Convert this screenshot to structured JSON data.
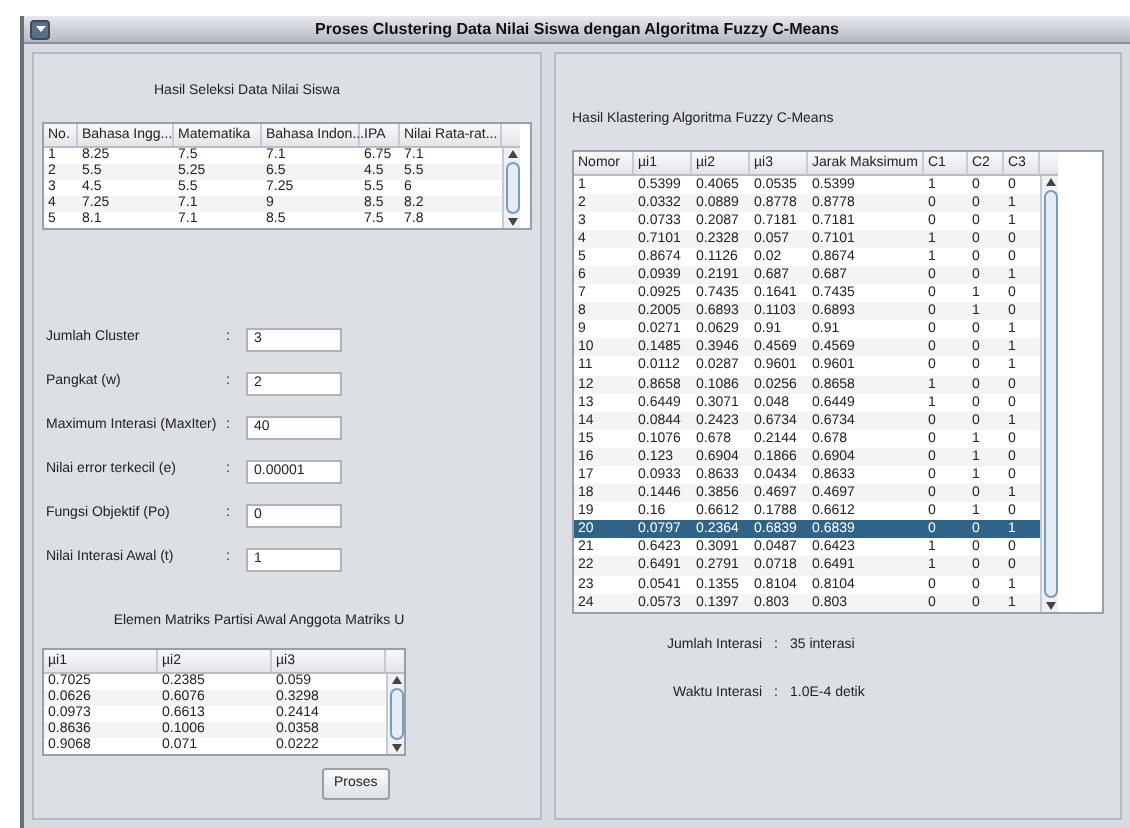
{
  "window": {
    "title": "Proses Clustering Data Nilai Siswa dengan Algoritma Fuzzy C-Means"
  },
  "selection_table": {
    "title": "Hasil Seleksi Data Nilai Siswa",
    "columns": [
      "No.",
      "Bahasa Ingg...",
      "Matematika",
      "Bahasa Indon...",
      "IPA",
      "Nilai Rata-rat..."
    ],
    "rows": [
      [
        "1",
        "8.25",
        "7.5",
        "7.1",
        "6.75",
        "7.1"
      ],
      [
        "2",
        "5.5",
        "5.25",
        "6.5",
        "4.5",
        "5.5"
      ],
      [
        "3",
        "4.5",
        "5.5",
        "7.25",
        "5.5",
        "6"
      ],
      [
        "4",
        "7.25",
        "7.1",
        "9",
        "8.5",
        "8.2"
      ],
      [
        "5",
        "8.1",
        "7.1",
        "8.5",
        "7.5",
        "7.8"
      ]
    ]
  },
  "params": [
    {
      "label": "Jumlah Cluster",
      "separator": ":",
      "value": "3"
    },
    {
      "label": "Pangkat (w)",
      "separator": ":",
      "value": "2"
    },
    {
      "label": "Maximum Interasi (MaxIter)",
      "separator": ":",
      "value": "40"
    },
    {
      "label": "Nilai error terkecil (e)",
      "separator": ":",
      "value": "0.00001"
    },
    {
      "label": "Fungsi Objektif (Po)",
      "separator": ":",
      "value": "0"
    },
    {
      "label": "Nilai Interasi Awal (t)",
      "separator": ":",
      "value": "1"
    }
  ],
  "matrix_table": {
    "title": "Elemen Matriks Partisi Awal Anggota Matriks U",
    "columns": [
      "µi1",
      "µi2",
      "µi3"
    ],
    "rows": [
      [
        "0.7025",
        "0.2385",
        "0.059"
      ],
      [
        "0.0626",
        "0.6076",
        "0.3298"
      ],
      [
        "0.0973",
        "0.6613",
        "0.2414"
      ],
      [
        "0.8636",
        "0.1006",
        "0.0358"
      ],
      [
        "0.9068",
        "0.071",
        "0.0222"
      ]
    ]
  },
  "process_button": "Proses",
  "result_table": {
    "title": "Hasil Klastering Algoritma Fuzzy C-Means",
    "columns": [
      "Nomor",
      "µi1",
      "µi2",
      "µi3",
      "Jarak Maksimum",
      "C1",
      "C2",
      "C3"
    ],
    "rows": [
      {
        "cells": [
          "1",
          "0.5399",
          "0.4065",
          "0.0535",
          "0.5399",
          "1",
          "0",
          "0"
        ],
        "selected": false
      },
      {
        "cells": [
          "2",
          "0.0332",
          "0.0889",
          "0.8778",
          "0.8778",
          "0",
          "0",
          "1"
        ],
        "selected": false
      },
      {
        "cells": [
          "3",
          "0.0733",
          "0.2087",
          "0.7181",
          "0.7181",
          "0",
          "0",
          "1"
        ],
        "selected": false
      },
      {
        "cells": [
          "4",
          "0.7101",
          "0.2328",
          "0.057",
          "0.7101",
          "1",
          "0",
          "0"
        ],
        "selected": false
      },
      {
        "cells": [
          "5",
          "0.8674",
          "0.1126",
          "0.02",
          "0.8674",
          "1",
          "0",
          "0"
        ],
        "selected": false
      },
      {
        "cells": [
          "6",
          "0.0939",
          "0.2191",
          "0.687",
          "0.687",
          "0",
          "0",
          "1"
        ],
        "selected": false
      },
      {
        "cells": [
          "7",
          "0.0925",
          "0.7435",
          "0.1641",
          "0.7435",
          "0",
          "1",
          "0"
        ],
        "selected": false
      },
      {
        "cells": [
          "8",
          "0.2005",
          "0.6893",
          "0.1103",
          "0.6893",
          "0",
          "1",
          "0"
        ],
        "selected": false
      },
      {
        "cells": [
          "9",
          "0.0271",
          "0.0629",
          "0.91",
          "0.91",
          "0",
          "0",
          "1"
        ],
        "selected": false
      },
      {
        "cells": [
          "10",
          "0.1485",
          "0.3946",
          "0.4569",
          "0.4569",
          "0",
          "0",
          "1"
        ],
        "selected": false
      },
      {
        "cells": [
          "11",
          "0.0112",
          "0.0287",
          "0.9601",
          "0.9601",
          "0",
          "0",
          "1"
        ],
        "selected": false
      },
      {
        "cells": [
          "12",
          "0.8658",
          "0.1086",
          "0.0256",
          "0.8658",
          "1",
          "0",
          "0"
        ],
        "selected": false
      },
      {
        "cells": [
          "13",
          "0.6449",
          "0.3071",
          "0.048",
          "0.6449",
          "1",
          "0",
          "0"
        ],
        "selected": false
      },
      {
        "cells": [
          "14",
          "0.0844",
          "0.2423",
          "0.6734",
          "0.6734",
          "0",
          "0",
          "1"
        ],
        "selected": false
      },
      {
        "cells": [
          "15",
          "0.1076",
          "0.678",
          "0.2144",
          "0.678",
          "0",
          "1",
          "0"
        ],
        "selected": false
      },
      {
        "cells": [
          "16",
          "0.123",
          "0.6904",
          "0.1866",
          "0.6904",
          "0",
          "1",
          "0"
        ],
        "selected": false
      },
      {
        "cells": [
          "17",
          "0.0933",
          "0.8633",
          "0.0434",
          "0.8633",
          "0",
          "1",
          "0"
        ],
        "selected": false
      },
      {
        "cells": [
          "18",
          "0.1446",
          "0.3856",
          "0.4697",
          "0.4697",
          "0",
          "0",
          "1"
        ],
        "selected": false
      },
      {
        "cells": [
          "19",
          "0.16",
          "0.6612",
          "0.1788",
          "0.6612",
          "0",
          "1",
          "0"
        ],
        "selected": false
      },
      {
        "cells": [
          "20",
          "0.0797",
          "0.2364",
          "0.6839",
          "0.6839",
          "0",
          "0",
          "1"
        ],
        "selected": true
      },
      {
        "cells": [
          "21",
          "0.6423",
          "0.3091",
          "0.0487",
          "0.6423",
          "1",
          "0",
          "0"
        ],
        "selected": false
      },
      {
        "cells": [
          "22",
          "0.6491",
          "0.2791",
          "0.0718",
          "0.6491",
          "1",
          "0",
          "0"
        ],
        "selected": false
      },
      {
        "cells": [
          "23",
          "0.0541",
          "0.1355",
          "0.8104",
          "0.8104",
          "0",
          "0",
          "1"
        ],
        "selected": false
      },
      {
        "cells": [
          "24",
          "0.0573",
          "0.1397",
          "0.803",
          "0.803",
          "0",
          "0",
          "1"
        ],
        "selected": false
      }
    ]
  },
  "summary": [
    {
      "label": "Jumlah Interasi",
      "separator": ":",
      "value": "35 interasi"
    },
    {
      "label": "Waktu Interasi",
      "separator": ":",
      "value": "1.0E-4 detik"
    }
  ]
}
